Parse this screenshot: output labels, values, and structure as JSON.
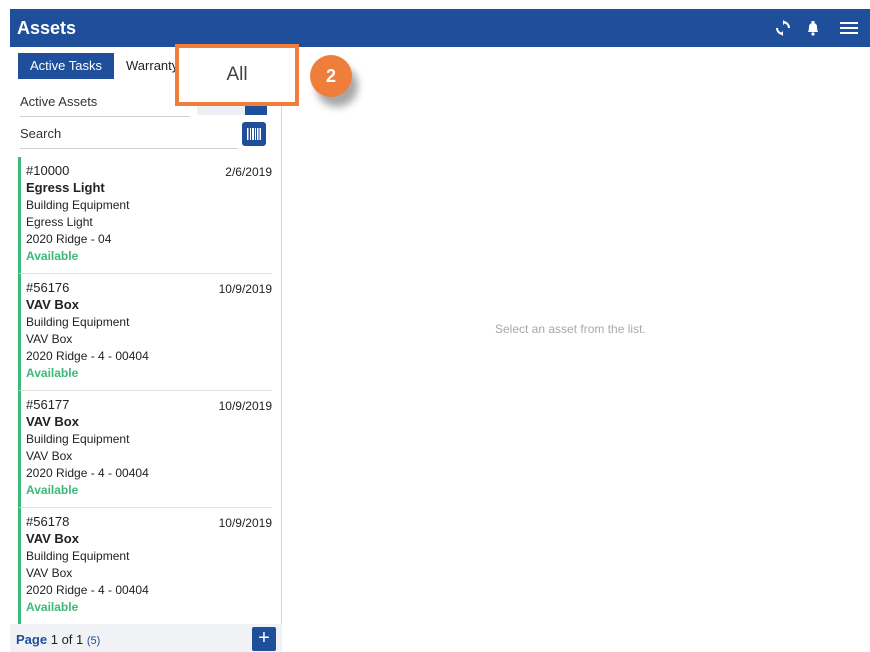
{
  "header": {
    "title": "Assets",
    "icons": [
      "sync-icon",
      "bell-icon",
      "menu-icon"
    ]
  },
  "tabs": [
    {
      "label": "Active Tasks",
      "active": true
    },
    {
      "label": "Warranty",
      "active": false
    }
  ],
  "filter": {
    "value": "Active Assets"
  },
  "search": {
    "placeholder": "Search"
  },
  "assets": [
    {
      "number": "#10000",
      "date": "2/6/2019",
      "name": "Egress Light",
      "category": "Building Equipment",
      "type": "Egress Light",
      "location": "2020 Ridge - 04",
      "status": "Available"
    },
    {
      "number": "#56176",
      "date": "10/9/2019",
      "name": "VAV Box",
      "category": "Building Equipment",
      "type": "VAV Box",
      "location": "2020 Ridge - 4 - 00404",
      "status": "Available"
    },
    {
      "number": "#56177",
      "date": "10/9/2019",
      "name": "VAV Box",
      "category": "Building Equipment",
      "type": "VAV Box",
      "location": "2020 Ridge - 4 - 00404",
      "status": "Available"
    },
    {
      "number": "#56178",
      "date": "10/9/2019",
      "name": "VAV Box",
      "category": "Building Equipment",
      "type": "VAV Box",
      "location": "2020 Ridge - 4 - 00404",
      "status": "Available"
    }
  ],
  "pagination": {
    "page_label": "Page",
    "current": "1",
    "of_label": "of",
    "total": "1",
    "count": "(5)"
  },
  "main": {
    "empty_message": "Select an asset from the list."
  },
  "callout": {
    "label": "All",
    "step": "2"
  },
  "colors": {
    "brand": "#1f4f9b",
    "available": "#3cb878",
    "callout": "#ef7e3a"
  }
}
